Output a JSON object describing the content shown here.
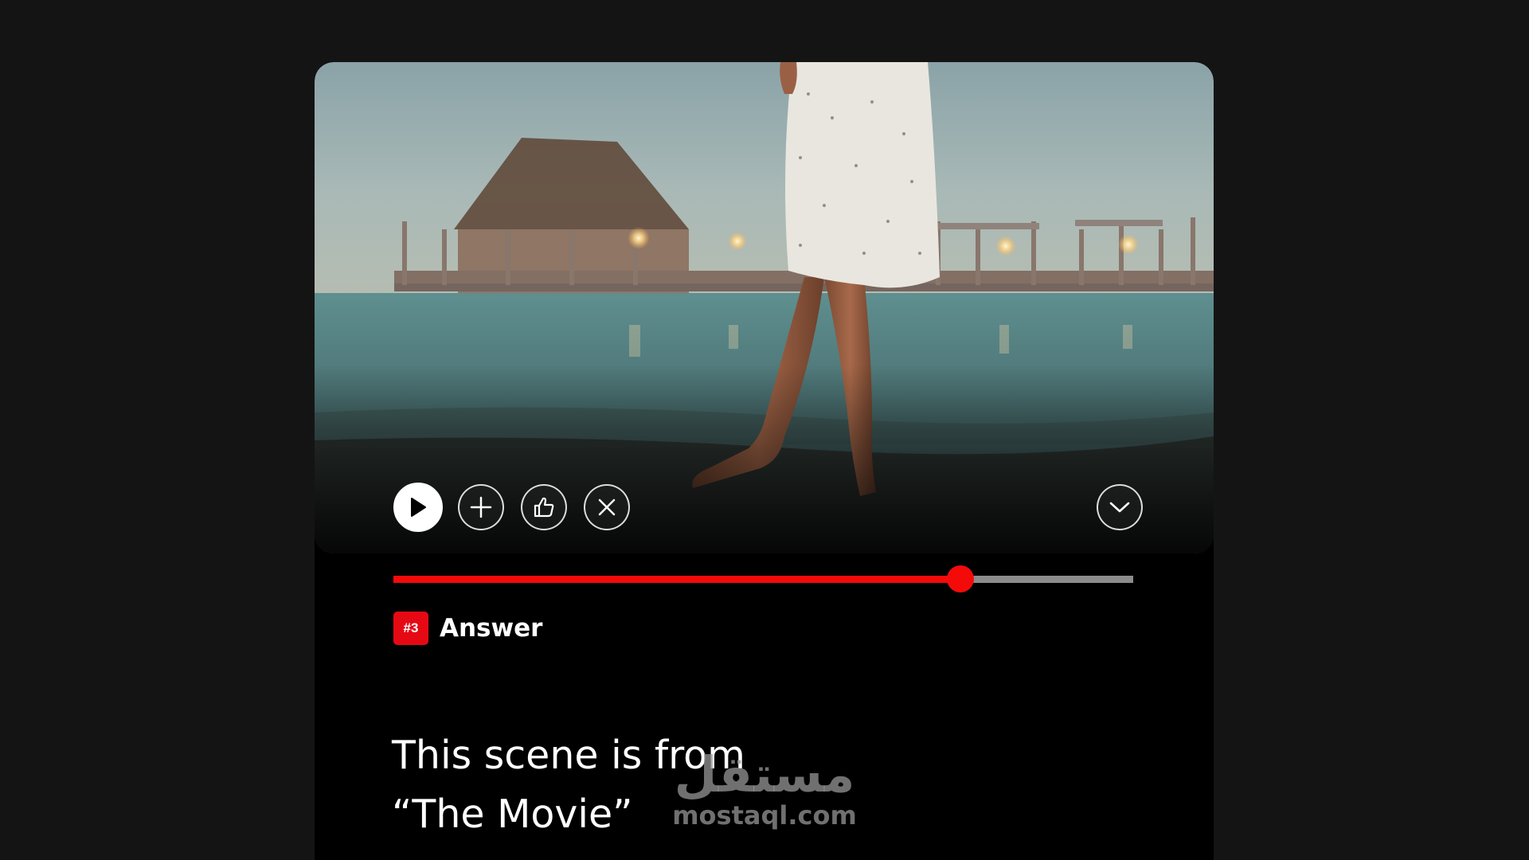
{
  "player": {
    "controls": {
      "play_icon": "play-icon",
      "add_icon": "plus-icon",
      "like_icon": "thumbs-up-icon",
      "dismiss_icon": "close-icon",
      "expand_icon": "chevron-down-icon"
    },
    "progress": {
      "fraction": 0.766,
      "fill_color": "#f50a0a",
      "track_color": "#8c8c8c"
    }
  },
  "answer": {
    "badge": "#3",
    "badge_color": "#e50914",
    "label": "Answer",
    "line1": "This scene is from",
    "line2": "“The Movie”"
  },
  "watermark": {
    "arabic": "مستقل",
    "latin": "mostaql.com"
  }
}
